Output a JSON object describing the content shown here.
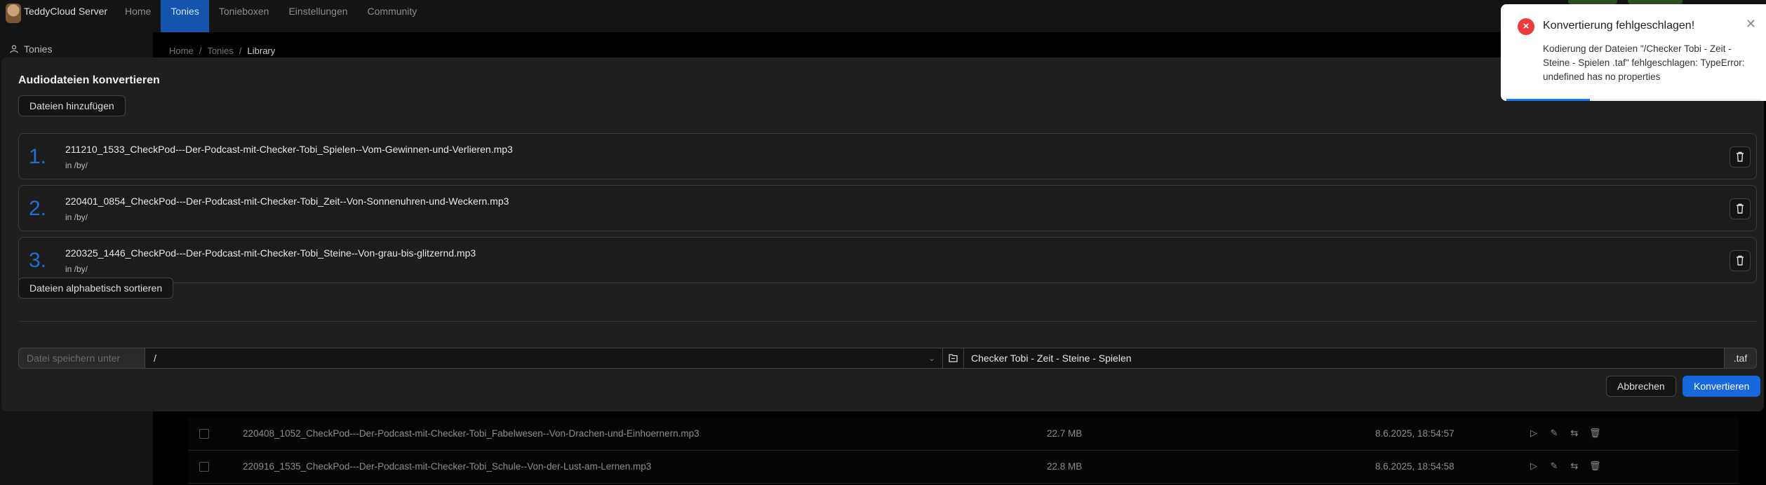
{
  "header": {
    "brand": "TeddyCloud Server",
    "nav": [
      "Home",
      "Tonies",
      "Tonieboxen",
      "Einstellungen",
      "Community"
    ],
    "active_nav": "Tonies"
  },
  "sidebar": {
    "item_label": "Tonies"
  },
  "breadcrumb": {
    "items": [
      "Home",
      "Tonies",
      "Library"
    ]
  },
  "modal": {
    "title": "Audiodateien konvertieren",
    "add_files_label": "Dateien hinzufügen",
    "files": [
      {
        "number": "1.",
        "name": "211210_1533_CheckPod---Der-Podcast-mit-Checker-Tobi_Spielen--Vom-Gewinnen-und-Verlieren.mp3",
        "path": "in /by/"
      },
      {
        "number": "2.",
        "name": "220401_0854_CheckPod---Der-Podcast-mit-Checker-Tobi_Zeit--Von-Sonnenuhren-und-Weckern.mp3",
        "path": "in /by/"
      },
      {
        "number": "3.",
        "name": "220325_1446_CheckPod---Der-Podcast-mit-Checker-Tobi_Steine--Von-grau-bis-glitzernd.mp3",
        "path": "in /by/"
      }
    ],
    "sort_label": "Dateien alphabetisch sortieren",
    "save_under_label": "Datei speichern unter",
    "save_path": "/",
    "filename_value": "Checker Tobi - Zeit - Steine - Spielen",
    "extension": ".taf",
    "cancel_label": "Abbrechen",
    "convert_label": "Konvertieren"
  },
  "table": {
    "rows": [
      {
        "name": "220408_1052_CheckPod---Der-Podcast-mit-Checker-Tobi_Fabelwesen--Von-Drachen-und-Einhoernern.mp3",
        "size": "22.7 MB",
        "date": "8.6.2025, 18:54:57"
      },
      {
        "name": "220916_1535_CheckPod---Der-Podcast-mit-Checker-Tobi_Schule--Von-der-Lust-am-Lernen.mp3",
        "size": "22.8 MB",
        "date": "8.6.2025, 18:54:58"
      }
    ]
  },
  "notification": {
    "title": "Konvertierung fehlgeschlagen!",
    "description": "Kodierung der Dateien \"/Checker Tobi - Zeit - Steine - Spielen .taf\" fehlgeschlagen: TypeError: undefined has no properties",
    "progress": 0.33
  },
  "colors": {
    "accent": "#1668dc",
    "error": "#ea3b3f",
    "nav_active": "#1554ad"
  }
}
